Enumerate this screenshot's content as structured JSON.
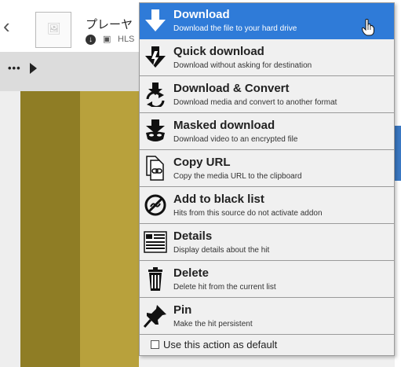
{
  "background": {
    "hit": {
      "title": "プレーヤ",
      "type_label": "HLS"
    }
  },
  "menu": {
    "items": [
      {
        "label": "Download",
        "description": "Download the file to your hard drive",
        "icon": "download-arrow-icon"
      },
      {
        "label": "Quick download",
        "description": "Download without asking for destination",
        "icon": "quick-download-icon"
      },
      {
        "label": "Download & Convert",
        "description": "Download media and convert to another format",
        "icon": "convert-icon"
      },
      {
        "label": "Masked download",
        "description": "Download video to an encrypted file",
        "icon": "mask-icon"
      },
      {
        "label": "Copy URL",
        "description": "Copy the media URL to the clipboard",
        "icon": "copy-link-icon"
      },
      {
        "label": "Add to black list",
        "description": "Hits from this source do not activate addon",
        "icon": "blacklist-icon"
      },
      {
        "label": "Details",
        "description": "Display details about the hit",
        "icon": "details-icon"
      },
      {
        "label": "Delete",
        "description": "Delete hit from the current list",
        "icon": "trash-icon"
      },
      {
        "label": "Pin",
        "description": "Make the hit persistent",
        "icon": "pin-icon"
      }
    ],
    "default_label": "Use this action as default",
    "default_checked": false
  },
  "colors": {
    "highlight": "#2f7bd8",
    "menu_bg": "#f0f0f0",
    "khaki_dark": "#8f7d25",
    "khaki_light": "#b8a13c"
  }
}
